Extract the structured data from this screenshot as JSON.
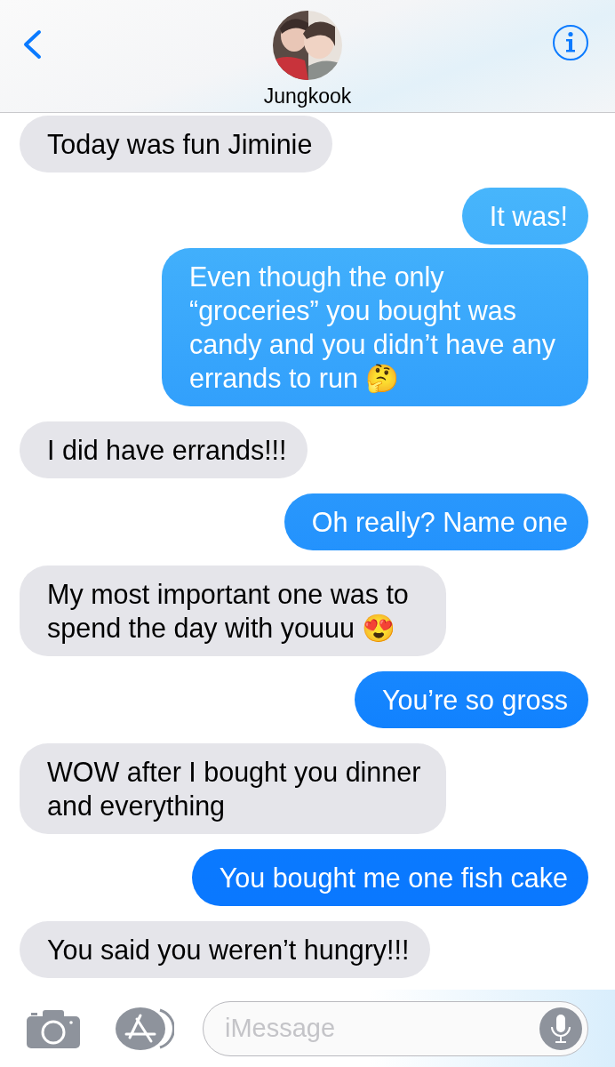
{
  "header": {
    "contact_name": "Jungkook"
  },
  "messages": [
    {
      "kind": "received",
      "text": "Today was fun Jiminie"
    },
    {
      "kind": "sent",
      "text": "It was!"
    },
    {
      "kind": "sent",
      "text": "Even though the only “groceries” you bought was candy and you didn’t have any errands to run 🤔"
    },
    {
      "kind": "received",
      "text": "I did have errands!!!"
    },
    {
      "kind": "sent",
      "text": "Oh really? Name one"
    },
    {
      "kind": "received",
      "text": "My most important one was to spend the day with youuu 😍"
    },
    {
      "kind": "sent",
      "text": "You’re so gross"
    },
    {
      "kind": "received",
      "text": "WOW after I bought you dinner and everything"
    },
    {
      "kind": "sent",
      "text": "You bought me one fish cake"
    },
    {
      "kind": "received",
      "text": "You said you weren’t hungry!!!"
    }
  ],
  "composer": {
    "placeholder": "iMessage"
  }
}
